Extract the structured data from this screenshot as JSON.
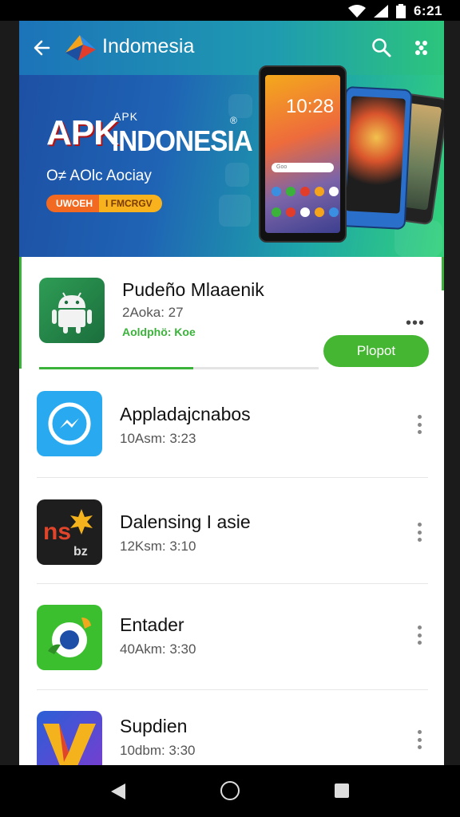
{
  "status_bar": {
    "time": "6:21"
  },
  "header": {
    "title": "Indomesia",
    "icons": [
      "back-arrow-icon",
      "logo-icon",
      "search-icon",
      "more-icon"
    ]
  },
  "banner": {
    "apk_small": "APK",
    "apk_big": "APK",
    "brand": "INDONESIA",
    "mark": "®",
    "subtitle": "O≠ AOlc Aociay",
    "pill_left": "UWOEH",
    "pill_right": "I FMCRGV",
    "phone_time": "10:28",
    "phone_search": "Goo"
  },
  "colors": {
    "accent": "#3bb33a",
    "header_blue": "#1f63b5",
    "install_green": "#45b632"
  },
  "apps": [
    {
      "title": "Pudeño Mlaaenik",
      "subtitle": "2Aoka: 27",
      "status": "Aoldphö: Koe",
      "action": "Plopot",
      "progress": 0.55,
      "menu": "•••"
    },
    {
      "title": "Appladajcnabos",
      "subtitle": "10Asm: 3:23"
    },
    {
      "title": "Dalensing I asie",
      "subtitle": "12Ksm: 3:10"
    },
    {
      "title": "Entader",
      "subtitle": "40Akm: 3:30"
    },
    {
      "title": "Supdien",
      "subtitle": "10dbm: 3:30"
    }
  ]
}
